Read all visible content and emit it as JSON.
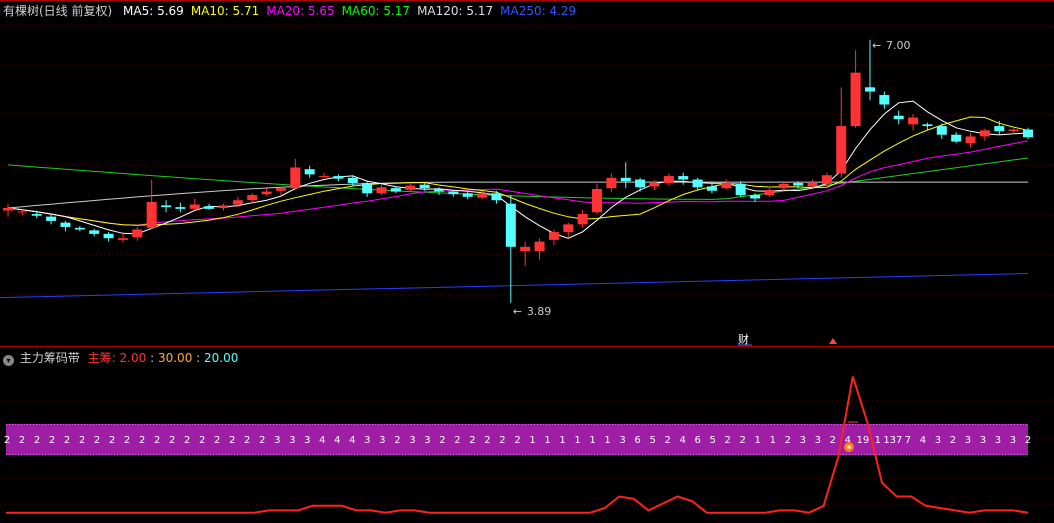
{
  "main_panel": {
    "title": "有棵树(日线 前复权)",
    "indicators": [
      {
        "label": "MA5:",
        "value": "5.69",
        "color": "#ffffff"
      },
      {
        "label": "MA10:",
        "value": "5.71",
        "color": "#ffff00"
      },
      {
        "label": "MA20:",
        "value": "5.65",
        "color": "#ff00ff"
      },
      {
        "label": "MA60:",
        "value": "5.17",
        "color": "#00ff00"
      },
      {
        "label": "MA120:",
        "value": "5.17",
        "color": "#dddddd"
      },
      {
        "label": "MA250:",
        "value": "4.29",
        "color": "#3355ff"
      }
    ],
    "high_label": "7.00",
    "low_label": "3.89",
    "event_marker": "财"
  },
  "sub_panel": {
    "title": "主力筹码带",
    "label_main": "主筹:",
    "value1": "2.00",
    "value2": "30.00",
    "value3": "20.00",
    "band_numbers": [
      "2",
      "2",
      "2",
      "2",
      "2",
      "2",
      "2",
      "2",
      "2",
      "2",
      "2",
      "2",
      "2",
      "2",
      "2",
      "2",
      "2",
      "2",
      "3",
      "3",
      "3",
      "4",
      "4",
      "4",
      "3",
      "3",
      "2",
      "3",
      "3",
      "2",
      "2",
      "2",
      "2",
      "2",
      "2",
      "1",
      "1",
      "1",
      "1",
      "1",
      "1",
      "3",
      "6",
      "5",
      "2",
      "4",
      "6",
      "5",
      "2",
      "2",
      "1",
      "1",
      "2",
      "3",
      "3",
      "2",
      "4",
      "19",
      "1",
      "137",
      "7",
      "4",
      "3",
      "2",
      "3",
      "3",
      "3",
      "3",
      "2"
    ]
  },
  "colors": {
    "up": "#ff3333",
    "down": "#54ffff",
    "band": "#9e1fa6",
    "line": "#ff2020"
  },
  "chart_data": [
    {
      "type": "candlestick",
      "title": "有棵树(日线 前复权)",
      "ylim": [
        3.6,
        7.3
      ],
      "candles": [
        [
          5.02,
          5.05,
          4.95,
          5.1
        ],
        [
          5.0,
          5.01,
          4.97,
          5.04
        ],
        [
          4.98,
          4.96,
          4.93,
          5.02
        ],
        [
          4.95,
          4.9,
          4.86,
          4.98
        ],
        [
          4.88,
          4.83,
          4.78,
          4.9
        ],
        [
          4.82,
          4.8,
          4.78,
          4.84
        ],
        [
          4.79,
          4.75,
          4.72,
          4.81
        ],
        [
          4.75,
          4.7,
          4.66,
          4.77
        ],
        [
          4.68,
          4.7,
          4.65,
          4.75
        ],
        [
          4.71,
          4.8,
          4.67,
          4.83
        ],
        [
          4.82,
          5.12,
          4.8,
          5.38
        ],
        [
          5.08,
          5.06,
          5.0,
          5.14
        ],
        [
          5.06,
          5.04,
          5.0,
          5.11
        ],
        [
          5.04,
          5.09,
          5.03,
          5.16
        ],
        [
          5.07,
          5.04,
          5.03,
          5.1
        ],
        [
          5.05,
          5.08,
          5.02,
          5.1
        ],
        [
          5.09,
          5.14,
          5.06,
          5.18
        ],
        [
          5.14,
          5.2,
          5.1,
          5.22
        ],
        [
          5.21,
          5.24,
          5.19,
          5.28
        ],
        [
          5.25,
          5.28,
          5.2,
          5.29
        ],
        [
          5.28,
          5.52,
          5.26,
          5.62
        ],
        [
          5.5,
          5.44,
          5.4,
          5.54
        ],
        [
          5.42,
          5.42,
          5.4,
          5.46
        ],
        [
          5.42,
          5.39,
          5.36,
          5.44
        ],
        [
          5.4,
          5.34,
          5.3,
          5.43
        ],
        [
          5.34,
          5.22,
          5.18,
          5.36
        ],
        [
          5.22,
          5.29,
          5.2,
          5.32
        ],
        [
          5.28,
          5.24,
          5.22,
          5.3
        ],
        [
          5.26,
          5.31,
          5.24,
          5.33
        ],
        [
          5.32,
          5.28,
          5.25,
          5.34
        ],
        [
          5.27,
          5.24,
          5.2,
          5.29
        ],
        [
          5.24,
          5.21,
          5.18,
          5.26
        ],
        [
          5.22,
          5.18,
          5.15,
          5.24
        ],
        [
          5.17,
          5.22,
          5.15,
          5.25
        ],
        [
          5.22,
          5.14,
          5.1,
          5.25
        ],
        [
          5.1,
          4.6,
          3.95,
          5.2
        ],
        [
          4.55,
          4.6,
          4.38,
          4.66
        ],
        [
          4.55,
          4.66,
          4.45,
          4.7
        ],
        [
          4.68,
          4.77,
          4.62,
          4.8
        ],
        [
          4.77,
          4.86,
          4.7,
          4.88
        ],
        [
          4.86,
          4.98,
          4.82,
          5.03
        ],
        [
          5.0,
          5.27,
          4.98,
          5.33
        ],
        [
          5.28,
          5.4,
          5.23,
          5.45
        ],
        [
          5.4,
          5.36,
          5.28,
          5.58
        ],
        [
          5.38,
          5.29,
          5.24,
          5.4
        ],
        [
          5.3,
          5.34,
          5.26,
          5.37
        ],
        [
          5.34,
          5.42,
          5.31,
          5.45
        ],
        [
          5.42,
          5.38,
          5.32,
          5.46
        ],
        [
          5.38,
          5.29,
          5.25,
          5.4
        ],
        [
          5.3,
          5.25,
          5.22,
          5.36
        ],
        [
          5.28,
          5.34,
          5.26,
          5.38
        ],
        [
          5.33,
          5.2,
          5.18,
          5.36
        ],
        [
          5.2,
          5.16,
          5.12,
          5.22
        ],
        [
          5.2,
          5.26,
          5.18,
          5.3
        ],
        [
          5.28,
          5.33,
          5.25,
          5.36
        ],
        [
          5.34,
          5.31,
          5.28,
          5.36
        ],
        [
          5.3,
          5.34,
          5.28,
          5.38
        ],
        [
          5.33,
          5.43,
          5.28,
          5.46
        ],
        [
          5.45,
          6.0,
          5.4,
          6.45
        ],
        [
          6.0,
          6.62,
          5.98,
          6.88
        ],
        [
          6.45,
          6.4,
          6.3,
          7.0
        ],
        [
          6.36,
          6.25,
          6.2,
          6.4
        ],
        [
          6.12,
          6.08,
          6.02,
          6.18
        ],
        [
          6.02,
          6.1,
          5.95,
          6.14
        ],
        [
          6.02,
          6.0,
          5.95,
          6.04
        ],
        [
          6.0,
          5.9,
          5.85,
          6.03
        ],
        [
          5.9,
          5.82,
          5.8,
          5.93
        ],
        [
          5.8,
          5.88,
          5.75,
          5.92
        ],
        [
          5.88,
          5.95,
          5.83,
          5.97
        ],
        [
          6.0,
          5.94,
          5.9,
          6.06
        ],
        [
          5.94,
          5.96,
          5.9,
          5.98
        ],
        [
          5.96,
          5.87,
          5.85,
          5.98
        ]
      ]
    },
    {
      "type": "line",
      "title": "主力筹码带",
      "band_value": 20.0,
      "values": [
        1,
        1,
        1,
        1,
        1,
        1,
        1,
        1,
        1,
        1,
        1,
        1,
        1,
        1,
        1,
        1,
        1,
        1,
        2,
        2,
        2,
        4,
        4,
        4,
        2,
        2,
        1,
        2,
        2,
        1,
        1,
        1,
        1,
        1,
        1,
        1,
        1,
        1,
        1,
        1,
        1,
        3,
        8,
        7,
        2,
        5,
        8,
        6,
        1,
        1,
        1,
        1,
        1,
        2,
        2,
        1,
        4,
        25,
        60,
        40,
        14,
        8,
        8,
        4,
        3,
        2,
        1,
        2,
        2,
        2,
        1
      ]
    }
  ]
}
